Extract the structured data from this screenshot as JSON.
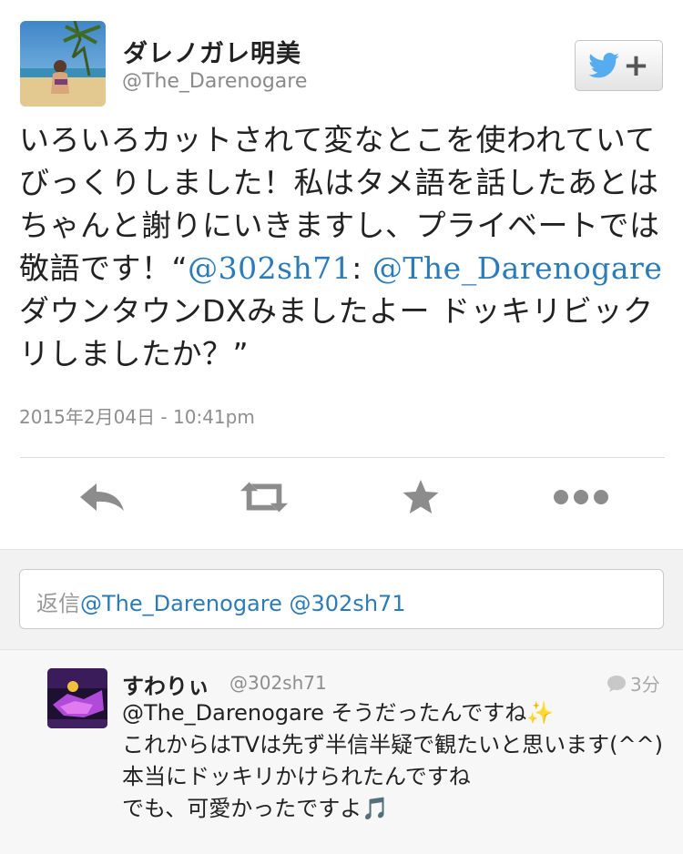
{
  "tweet": {
    "user_name": "ダレノガレ明美",
    "user_handle": "@The_Darenogare",
    "text_part1": "いろいろカットされて変なとこを使われていてびっくりしました！私はタメ語を話したあとはちゃんと謝りにいきますし、プライベートでは敬語です！“",
    "mention1": "@302sh71",
    "colon": ":",
    "mention2": "@The_Darenogare",
    "text_part2": " ダウンタウンDXみましたよー ドッキリビックリしましたか？”",
    "timestamp": "2015年2月04日 - 10:41pm"
  },
  "actions": {
    "reply_icon": "reply-icon",
    "retweet_icon": "retweet-icon",
    "favorite_icon": "star-icon",
    "more_icon": "more-icon"
  },
  "reply_box": {
    "prefix": "返信",
    "mentions": "@The_Darenogare @302sh71"
  },
  "reply": {
    "user_name": "すわりぃ",
    "user_handle": "@302sh71",
    "time": "3分",
    "mention": "@The_Darenogare",
    "line1_rest": " そうだったんですね",
    "line1_emoji": "✨",
    "line2": "これからはTVは先ず半信半疑で観たいと思います(^^) 本当にドッキリかけられたんですね",
    "line3": "でも、可愛かったですよ",
    "line3_emoji": "🎵"
  },
  "colors": {
    "accent_blue": "#2b7bb9",
    "twitter_bird": "#55acee",
    "muted_gray": "#8e8e8e"
  }
}
